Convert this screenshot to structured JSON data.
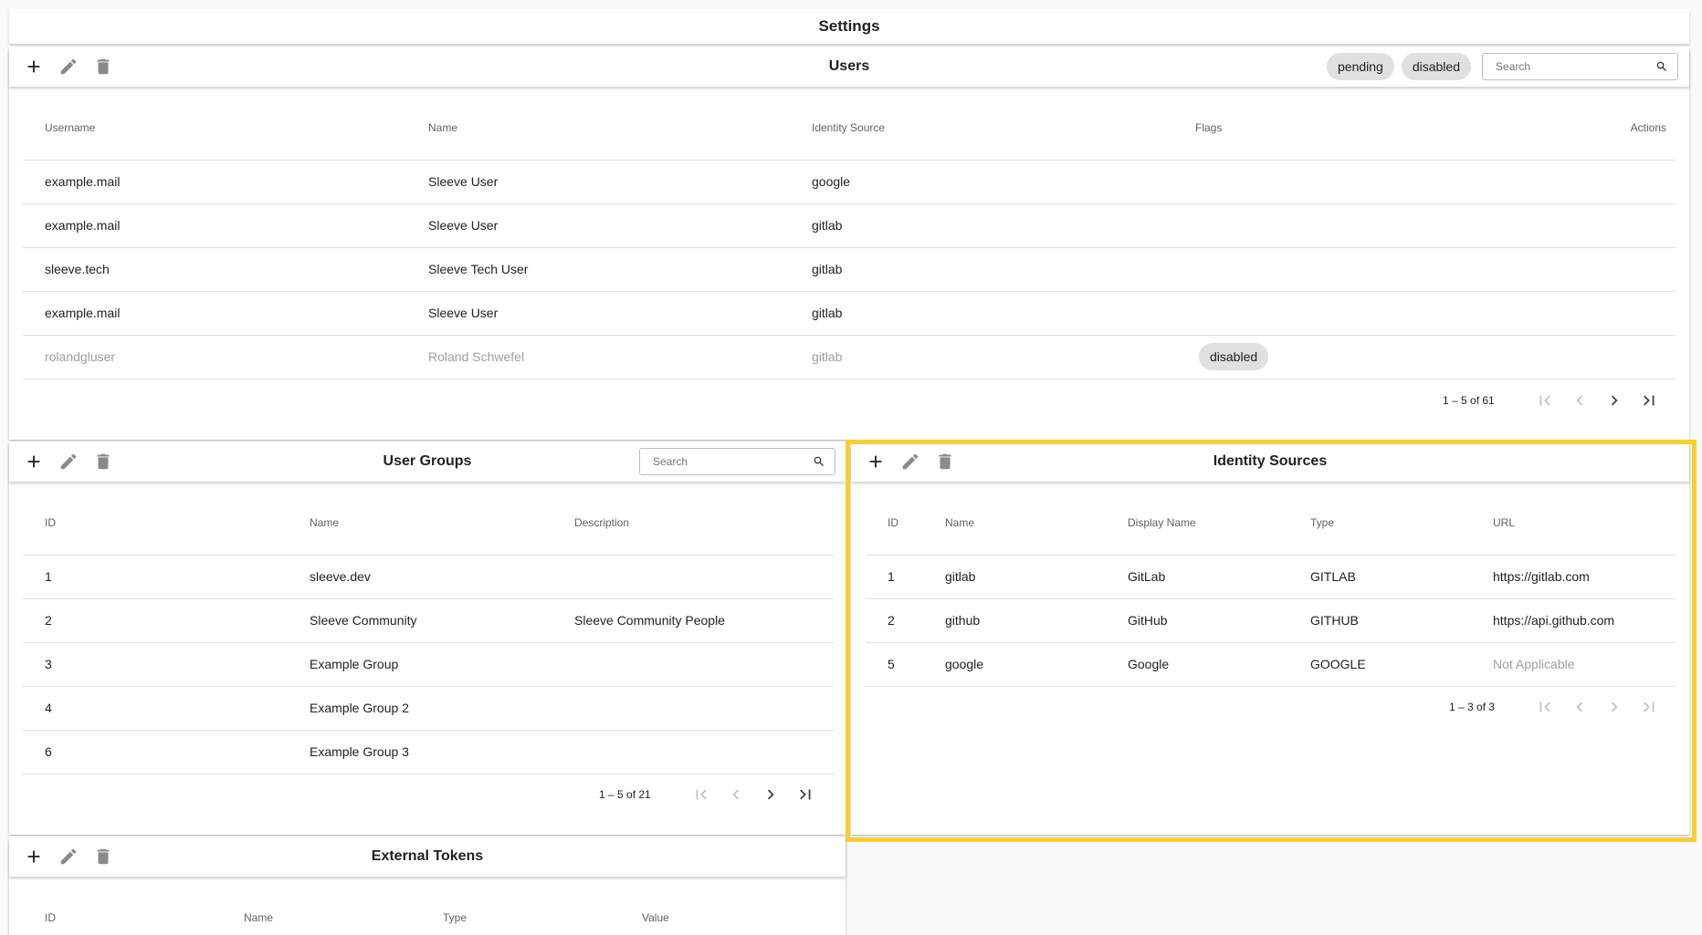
{
  "settings": {
    "title": "Settings"
  },
  "users": {
    "title": "Users",
    "chips": [
      "pending",
      "disabled"
    ],
    "search_placeholder": "Search",
    "columns": [
      "Username",
      "Name",
      "Identity Source",
      "Flags",
      "Actions"
    ],
    "rows": [
      {
        "username": "example.mail",
        "name": "Sleeve User",
        "source": "google",
        "flag": ""
      },
      {
        "username": "example.mail",
        "name": "Sleeve User",
        "source": "gitlab",
        "flag": ""
      },
      {
        "username": "sleeve.tech",
        "name": "Sleeve Tech User",
        "source": "gitlab",
        "flag": ""
      },
      {
        "username": "example.mail",
        "name": "Sleeve User",
        "source": "gitlab",
        "flag": ""
      },
      {
        "username": "rolandgluser",
        "name": "Roland Schwefel",
        "source": "gitlab",
        "flag": "disabled"
      }
    ],
    "range": "1 – 5 of 61"
  },
  "groups": {
    "title": "User Groups",
    "search_placeholder": "Search",
    "columns": [
      "ID",
      "Name",
      "Description"
    ],
    "rows": [
      {
        "id": "1",
        "name": "sleeve.dev",
        "description": ""
      },
      {
        "id": "2",
        "name": "Sleeve Community",
        "description": "Sleeve Community People"
      },
      {
        "id": "3",
        "name": "Example Group",
        "description": ""
      },
      {
        "id": "4",
        "name": "Example Group 2",
        "description": ""
      },
      {
        "id": "6",
        "name": "Example Group 3",
        "description": ""
      }
    ],
    "range": "1 – 5 of 21"
  },
  "sources": {
    "title": "Identity Sources",
    "columns": [
      "ID",
      "Name",
      "Display Name",
      "Type",
      "URL"
    ],
    "rows": [
      {
        "id": "1",
        "name": "gitlab",
        "display": "GitLab",
        "type": "GITLAB",
        "url": "https://gitlab.com"
      },
      {
        "id": "2",
        "name": "github",
        "display": "GitHub",
        "type": "GITHUB",
        "url": "https://api.github.com"
      },
      {
        "id": "5",
        "name": "google",
        "display": "Google",
        "type": "GOOGLE",
        "url": "Not Applicable"
      }
    ],
    "range": "1 – 3 of 3"
  },
  "tokens": {
    "title": "External Tokens",
    "columns": [
      "ID",
      "Name",
      "Type",
      "Value"
    ]
  },
  "colors": {
    "highlight": "#f7d030",
    "chip": "#e0e0e0",
    "disabled_text": "#9e9e9e"
  }
}
